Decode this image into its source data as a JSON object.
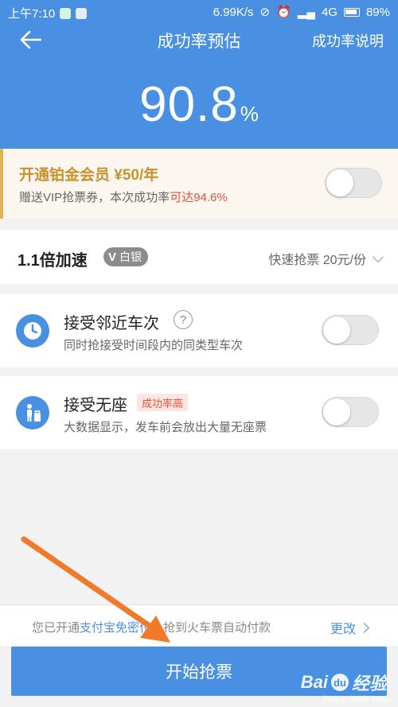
{
  "statusbar": {
    "time": "上午7:10",
    "speed": "6.99K/s",
    "network": "4G",
    "battery": "89%"
  },
  "navbar": {
    "title": "成功率预估",
    "right_link": "成功率说明"
  },
  "success_rate": {
    "value": "90.8",
    "unit": "%"
  },
  "vip": {
    "title": "开通铂金会员 ¥50/年",
    "subtitle_prefix": "赠送VIP抢票券，本次成功率",
    "subtitle_highlight": "可达94.6%",
    "enabled": false
  },
  "speed": {
    "title": "1.1倍加速",
    "badge_letter": "V",
    "badge_label": "白银",
    "option": "快速抢票 20元/份"
  },
  "options": [
    {
      "title": "接受邻近车次",
      "help": "?",
      "subtitle": "同时抢接受时间段内的同类型车次",
      "icon": "clock-icon",
      "enabled": false
    },
    {
      "title": "接受无座",
      "tag": "成功率高",
      "subtitle": "大数据显示，发车前会放出大量无座票",
      "icon": "standing-person-icon",
      "enabled": false
    }
  ],
  "payment": {
    "prefix": "您已开通",
    "link": "支付宝免密付",
    "suffix": "，抢到火车票自动付款",
    "change_label": "更改"
  },
  "start_button": {
    "label": "开始抢票"
  },
  "watermark": {
    "brand": "Bai",
    "brand_cn": "经验",
    "url": "jingyan.baidu.com"
  },
  "colors": {
    "primary": "#4a90e2",
    "gold": "#c9922c",
    "highlight": "#e6533c",
    "annotation_arrow": "#f07a2a"
  }
}
